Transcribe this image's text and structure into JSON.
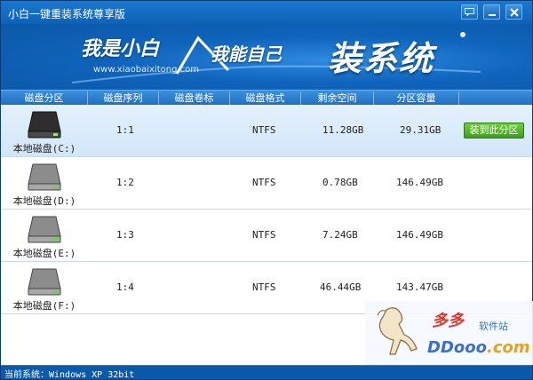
{
  "window": {
    "title": "小白一键重装系统尊享版"
  },
  "titlebar_buttons": [
    {
      "name": "feedback-icon",
      "glyph": "▭"
    },
    {
      "name": "minimize-icon",
      "glyph": "—"
    },
    {
      "name": "close-icon",
      "glyph": "✕"
    }
  ],
  "banner": {
    "slogan1": "我是小白",
    "url": "www.xiaobaixitong.com",
    "slogan2": "我能自己",
    "slogan3": "装系统"
  },
  "table": {
    "headers": [
      "磁盘分区",
      "磁盘序列",
      "磁盘卷标",
      "磁盘格式",
      "剩余空间",
      "分区容量"
    ],
    "rows": [
      {
        "name": "本地磁盘(C:)",
        "seq": "1:1",
        "label": "",
        "format": "NTFS",
        "free": "11.28GB",
        "size": "29.31GB",
        "selected": true
      },
      {
        "name": "本地磁盘(D:)",
        "seq": "1:2",
        "label": "",
        "format": "NTFS",
        "free": "0.78GB",
        "size": "146.49GB",
        "selected": false
      },
      {
        "name": "本地磁盘(E:)",
        "seq": "1:3",
        "label": "",
        "format": "NTFS",
        "free": "7.24GB",
        "size": "146.49GB",
        "selected": false
      },
      {
        "name": "本地磁盘(F:)",
        "seq": "1:4",
        "label": "",
        "format": "NTFS",
        "free": "46.44GB",
        "size": "143.47GB",
        "selected": false
      }
    ],
    "install_label": "装到此分区"
  },
  "watermark": {
    "cn": "多多",
    "cn2": "软件站",
    "en_main": "DDooo",
    "en_tld": ".com"
  },
  "status": {
    "text": "当前系统：Windows XP 32bit"
  },
  "colors": {
    "accent": "#0d62b5",
    "button_green": "#4fae26",
    "selected_row": "#d8eafb"
  }
}
